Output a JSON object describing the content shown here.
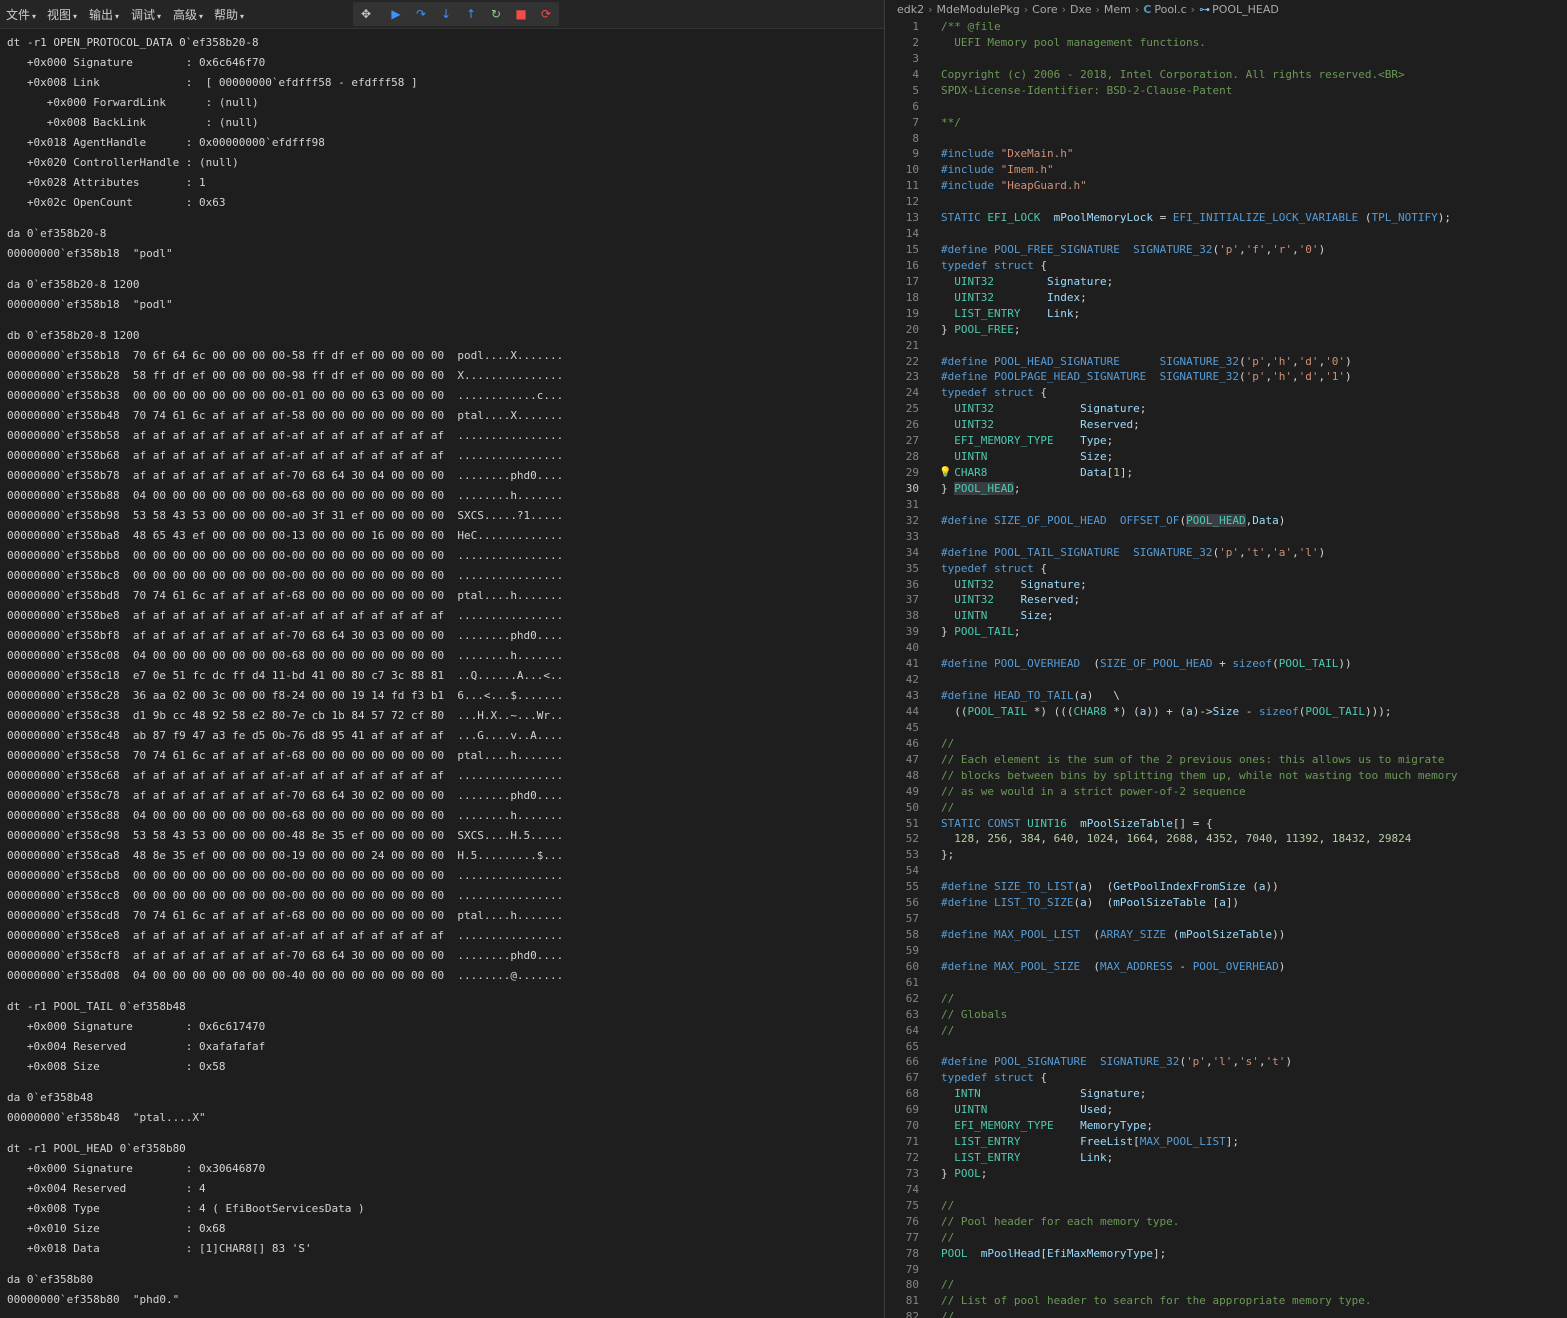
{
  "menubar": {
    "items": [
      "文件",
      "视图",
      "输出",
      "调试",
      "高级",
      "帮助"
    ]
  },
  "debug_toolbar": {
    "buttons": [
      "move-handle",
      "continue",
      "step-over",
      "step-into",
      "step-out",
      "restart",
      "stop",
      "disconnect"
    ]
  },
  "console": {
    "lines": [
      "dt -r1 OPEN_PROTOCOL_DATA 0`ef358b20-8",
      "   +0x000 Signature        : 0x6c646f70",
      "   +0x008 Link             :  [ 00000000`efdfff58 - efdfff58 ]",
      "      +0x000 ForwardLink      : (null)",
      "      +0x008 BackLink         : (null)",
      "   +0x018 AgentHandle      : 0x00000000`efdfff98",
      "   +0x020 ControllerHandle : (null)",
      "   +0x028 Attributes       : 1",
      "   +0x02c OpenCount        : 0x63",
      "",
      "da 0`ef358b20-8",
      "00000000`ef358b18  \"podl\"",
      "",
      "da 0`ef358b20-8 1200",
      "00000000`ef358b18  \"podl\"",
      "",
      "db 0`ef358b20-8 1200",
      "00000000`ef358b18  70 6f 64 6c 00 00 00 00-58 ff df ef 00 00 00 00  podl....X.......",
      "00000000`ef358b28  58 ff df ef 00 00 00 00-98 ff df ef 00 00 00 00  X...............",
      "00000000`ef358b38  00 00 00 00 00 00 00 00-01 00 00 00 63 00 00 00  ............c...",
      "00000000`ef358b48  70 74 61 6c af af af af-58 00 00 00 00 00 00 00  ptal....X.......",
      "00000000`ef358b58  af af af af af af af af-af af af af af af af af  ................",
      "00000000`ef358b68  af af af af af af af af-af af af af af af af af  ................",
      "00000000`ef358b78  af af af af af af af af-70 68 64 30 04 00 00 00  ........phd0....",
      "00000000`ef358b88  04 00 00 00 00 00 00 00-68 00 00 00 00 00 00 00  ........h.......",
      "00000000`ef358b98  53 58 43 53 00 00 00 00-a0 3f 31 ef 00 00 00 00  SXCS.....?1.....",
      "00000000`ef358ba8  48 65 43 ef 00 00 00 00-13 00 00 00 16 00 00 00  HeC.............",
      "00000000`ef358bb8  00 00 00 00 00 00 00 00-00 00 00 00 00 00 00 00  ................",
      "00000000`ef358bc8  00 00 00 00 00 00 00 00-00 00 00 00 00 00 00 00  ................",
      "00000000`ef358bd8  70 74 61 6c af af af af-68 00 00 00 00 00 00 00  ptal....h.......",
      "00000000`ef358be8  af af af af af af af af-af af af af af af af af  ................",
      "00000000`ef358bf8  af af af af af af af af-70 68 64 30 03 00 00 00  ........phd0....",
      "00000000`ef358c08  04 00 00 00 00 00 00 00-68 00 00 00 00 00 00 00  ........h.......",
      "00000000`ef358c18  e7 0e 51 fc dc ff d4 11-bd 41 00 80 c7 3c 88 81  ..Q......A...<..",
      "00000000`ef358c28  36 aa 02 00 3c 00 00 f8-24 00 00 19 14 fd f3 b1  6...<...$.......",
      "00000000`ef358c38  d1 9b cc 48 92 58 e2 80-7e cb 1b 84 57 72 cf 80  ...H.X..~...Wr..",
      "00000000`ef358c48  ab 87 f9 47 a3 fe d5 0b-76 d8 95 41 af af af af  ...G....v..A....",
      "00000000`ef358c58  70 74 61 6c af af af af-68 00 00 00 00 00 00 00  ptal....h.......",
      "00000000`ef358c68  af af af af af af af af-af af af af af af af af  ................",
      "00000000`ef358c78  af af af af af af af af-70 68 64 30 02 00 00 00  ........phd0....",
      "00000000`ef358c88  04 00 00 00 00 00 00 00-68 00 00 00 00 00 00 00  ........h.......",
      "00000000`ef358c98  53 58 43 53 00 00 00 00-48 8e 35 ef 00 00 00 00  SXCS....H.5.....",
      "00000000`ef358ca8  48 8e 35 ef 00 00 00 00-19 00 00 00 24 00 00 00  H.5.........$...",
      "00000000`ef358cb8  00 00 00 00 00 00 00 00-00 00 00 00 00 00 00 00  ................",
      "00000000`ef358cc8  00 00 00 00 00 00 00 00-00 00 00 00 00 00 00 00  ................",
      "00000000`ef358cd8  70 74 61 6c af af af af-68 00 00 00 00 00 00 00  ptal....h.......",
      "00000000`ef358ce8  af af af af af af af af-af af af af af af af af  ................",
      "00000000`ef358cf8  af af af af af af af af-70 68 64 30 00 00 00 00  ........phd0....",
      "00000000`ef358d08  04 00 00 00 00 00 00 00-40 00 00 00 00 00 00 00  ........@.......",
      "",
      "dt -r1 POOL_TAIL 0`ef358b48",
      "   +0x000 Signature        : 0x6c617470",
      "   +0x004 Reserved         : 0xafafafaf",
      "   +0x008 Size             : 0x58",
      "",
      "da 0`ef358b48",
      "00000000`ef358b48  \"ptal....X\"",
      "",
      "dt -r1 POOL_HEAD 0`ef358b80",
      "   +0x000 Signature        : 0x30646870",
      "   +0x004 Reserved         : 4",
      "   +0x008 Type             : 4 ( EfiBootServicesData )",
      "   +0x010 Size             : 0x68",
      "   +0x018 Data             : [1]CHAR8[] 83 'S'",
      "",
      "da 0`ef358b80",
      "00000000`ef358b80  \"phd0.\""
    ]
  },
  "breadcrumb": {
    "parts": [
      "edk2",
      "MdeModulePkg",
      "Core",
      "Dxe",
      "Mem",
      "Pool.c",
      "POOL_HEAD"
    ]
  },
  "editor": {
    "active_line": 30,
    "lines": [
      "/** @file",
      "  UEFI Memory pool management functions.",
      "",
      "Copyright (c) 2006 - 2018, Intel Corporation. All rights reserved.<BR>",
      "SPDX-License-Identifier: BSD-2-Clause-Patent",
      "",
      "**/",
      "",
      "#include \"DxeMain.h\"",
      "#include \"Imem.h\"",
      "#include \"HeapGuard.h\"",
      "",
      "STATIC EFI_LOCK  mPoolMemoryLock = EFI_INITIALIZE_LOCK_VARIABLE (TPL_NOTIFY);",
      "",
      "#define POOL_FREE_SIGNATURE  SIGNATURE_32('p','f','r','0')",
      "typedef struct {",
      "  UINT32        Signature;",
      "  UINT32        Index;",
      "  LIST_ENTRY    Link;",
      "} POOL_FREE;",
      "",
      "#define POOL_HEAD_SIGNATURE      SIGNATURE_32('p','h','d','0')",
      "#define POOLPAGE_HEAD_SIGNATURE  SIGNATURE_32('p','h','d','1')",
      "typedef struct {",
      "  UINT32             Signature;",
      "  UINT32             Reserved;",
      "  EFI_MEMORY_TYPE    Type;",
      "  UINTN              Size;",
      "  CHAR8              Data[1];",
      "} POOL_HEAD;",
      "",
      "#define SIZE_OF_POOL_HEAD  OFFSET_OF(POOL_HEAD,Data)",
      "",
      "#define POOL_TAIL_SIGNATURE  SIGNATURE_32('p','t','a','l')",
      "typedef struct {",
      "  UINT32    Signature;",
      "  UINT32    Reserved;",
      "  UINTN     Size;",
      "} POOL_TAIL;",
      "",
      "#define POOL_OVERHEAD  (SIZE_OF_POOL_HEAD + sizeof(POOL_TAIL))",
      "",
      "#define HEAD_TO_TAIL(a)   \\",
      "  ((POOL_TAIL *) (((CHAR8 *) (a)) + (a)->Size - sizeof(POOL_TAIL)));",
      "",
      "//",
      "// Each element is the sum of the 2 previous ones: this allows us to migrate",
      "// blocks between bins by splitting them up, while not wasting too much memory",
      "// as we would in a strict power-of-2 sequence",
      "//",
      "STATIC CONST UINT16  mPoolSizeTable[] = {",
      "  128, 256, 384, 640, 1024, 1664, 2688, 4352, 7040, 11392, 18432, 29824",
      "};",
      "",
      "#define SIZE_TO_LIST(a)  (GetPoolIndexFromSize (a))",
      "#define LIST_TO_SIZE(a)  (mPoolSizeTable [a])",
      "",
      "#define MAX_POOL_LIST  (ARRAY_SIZE (mPoolSizeTable))",
      "",
      "#define MAX_POOL_SIZE  (MAX_ADDRESS - POOL_OVERHEAD)",
      "",
      "//",
      "// Globals",
      "//",
      "",
      "#define POOL_SIGNATURE  SIGNATURE_32('p','l','s','t')",
      "typedef struct {",
      "  INTN               Signature;",
      "  UINTN              Used;",
      "  EFI_MEMORY_TYPE    MemoryType;",
      "  LIST_ENTRY         FreeList[MAX_POOL_LIST];",
      "  LIST_ENTRY         Link;",
      "} POOL;",
      "",
      "//",
      "// Pool header for each memory type.",
      "//",
      "POOL  mPoolHead[EfiMaxMemoryType];",
      "",
      "//",
      "// List of pool header to search for the appropriate memory type.",
      "//"
    ]
  }
}
